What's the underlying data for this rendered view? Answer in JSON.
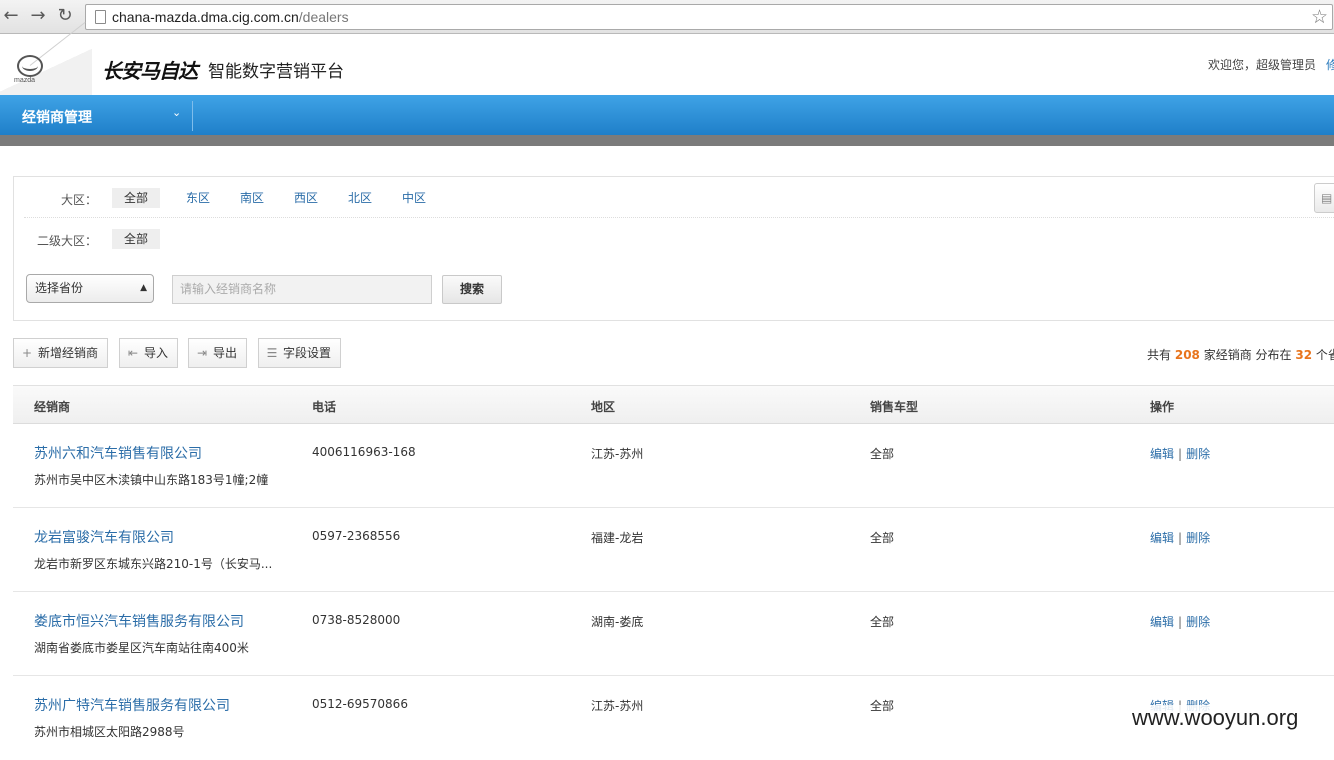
{
  "browser": {
    "url_host": "chana-mazda.dma.cig.com.cn",
    "url_path": "/dealers"
  },
  "header": {
    "logo_word": "mazda",
    "brand_name": "长安马自达",
    "brand_sub": "智能数字营销平台",
    "welcome": "欢迎您，超级管理员",
    "welcome_extra": "修"
  },
  "nav": {
    "title": "经销商管理"
  },
  "filters": {
    "region_label": "大区：",
    "regions": [
      "全部",
      "东区",
      "南区",
      "西区",
      "北区",
      "中区"
    ],
    "subregion_label": "二级大区：",
    "subregions": [
      "全部"
    ],
    "province_select": "选择省份",
    "search_placeholder": "请输入经销商名称",
    "search_button": "搜索"
  },
  "toolbar": {
    "add": "新增经销商",
    "import": "导入",
    "export": "导出",
    "fields": "字段设置"
  },
  "summary": {
    "prefix": "共有",
    "dealer_count": "208",
    "mid": "家经销商 分布在",
    "province_count": "32",
    "suffix": "个省"
  },
  "table": {
    "columns": [
      "经销商",
      "电话",
      "地区",
      "销售车型",
      "操作"
    ],
    "edit_label": "编辑",
    "delete_label": "删除",
    "rows": [
      {
        "name": "苏州六和汽车销售有限公司",
        "address": "苏州市吴中区木渎镇中山东路183号1幢;2幢",
        "phone": "4006116963-168",
        "region": "江苏-苏州",
        "models": "全部"
      },
      {
        "name": "龙岩富骏汽车有限公司",
        "address": "龙岩市新罗区东城东兴路210-1号（长安马...",
        "phone": "0597-2368556",
        "region": "福建-龙岩",
        "models": "全部"
      },
      {
        "name": "娄底市恒兴汽车销售服务有限公司",
        "address": "湖南省娄底市娄星区汽车南站往南400米",
        "phone": "0738-8528000",
        "region": "湖南-娄底",
        "models": "全部"
      },
      {
        "name": "苏州广特汽车销售服务有限公司",
        "address": "苏州市相城区太阳路2988号",
        "phone": "0512-69570866",
        "region": "江苏-苏州",
        "models": "全部"
      }
    ]
  },
  "watermark": "www.wooyun.org"
}
